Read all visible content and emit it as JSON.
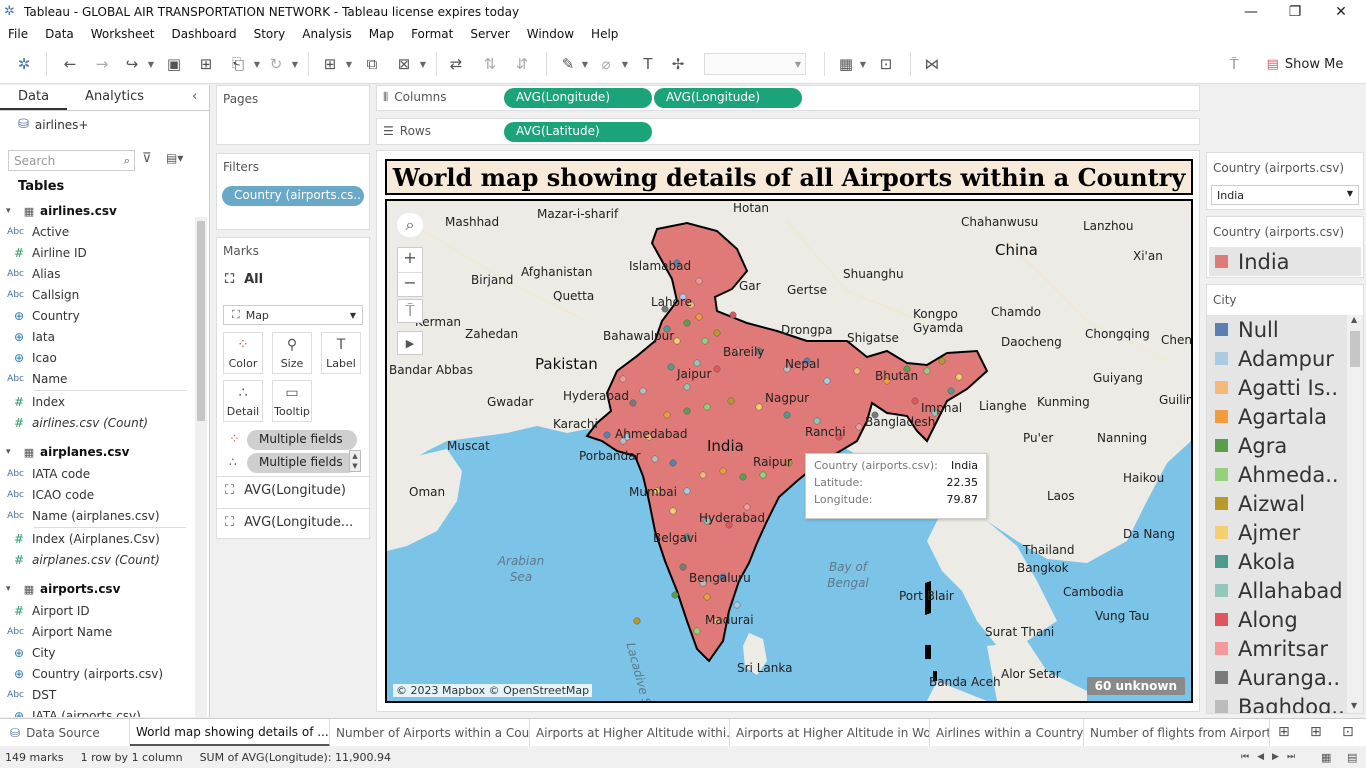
{
  "window": {
    "title": "Tableau - GLOBAL AIR TRANSPORTATION NETWORK - Tableau license expires today",
    "minimize": "—",
    "restore": "❐",
    "close": "✕"
  },
  "menu": [
    "File",
    "Data",
    "Worksheet",
    "Dashboard",
    "Story",
    "Analysis",
    "Map",
    "Format",
    "Server",
    "Window",
    "Help"
  ],
  "toolbar": {
    "show_me": "Show Me"
  },
  "datapane": {
    "tabs": [
      "Data",
      "Analytics"
    ],
    "source": "airlines+",
    "search_placeholder": "Search",
    "tables_label": "Tables",
    "tables": [
      {
        "name": "airlines.csv",
        "fields": [
          {
            "type": "Abc",
            "name": "Active"
          },
          {
            "type": "#",
            "name": "Airline ID"
          },
          {
            "type": "Abc",
            "name": "Alias"
          },
          {
            "type": "Abc",
            "name": "Callsign"
          },
          {
            "type": "globe",
            "name": "Country"
          },
          {
            "type": "globe",
            "name": "Iata"
          },
          {
            "type": "globe",
            "name": "Icao"
          },
          {
            "type": "Abc",
            "name": "Name"
          },
          {
            "type": "#",
            "name": "Index"
          },
          {
            "type": "#",
            "name": "airlines.csv (Count)"
          }
        ]
      },
      {
        "name": "airplanes.csv",
        "fields": [
          {
            "type": "Abc",
            "name": "IATA code"
          },
          {
            "type": "Abc",
            "name": "ICAO code"
          },
          {
            "type": "Abc",
            "name": "Name (airplanes.csv)"
          },
          {
            "type": "#",
            "name": "Index (Airplanes.Csv)"
          },
          {
            "type": "#",
            "name": "airplanes.csv (Count)"
          }
        ]
      },
      {
        "name": "airports.csv",
        "fields": [
          {
            "type": "#",
            "name": "Airport ID"
          },
          {
            "type": "Abc",
            "name": "Airport Name"
          },
          {
            "type": "globe",
            "name": "City"
          },
          {
            "type": "globe",
            "name": "Country (airports.csv)"
          },
          {
            "type": "Abc",
            "name": "DST"
          },
          {
            "type": "globe",
            "name": "IATA (airports.csv)"
          }
        ]
      }
    ]
  },
  "pages_label": "Pages",
  "filters": {
    "label": "Filters",
    "pill": "Country (airports.cs.."
  },
  "marks": {
    "label": "Marks",
    "all": "All",
    "type": "Map",
    "buttons": [
      "Color",
      "Size",
      "Label",
      "Detail",
      "Tooltip"
    ],
    "fields": [
      "Multiple fields",
      "Multiple fields"
    ],
    "layers": [
      "AVG(Longitude)",
      "AVG(Longitude..."
    ]
  },
  "shelves": {
    "columns_label": "Columns",
    "columns": [
      "AVG(Longitude)",
      "AVG(Longitude)"
    ],
    "rows_label": "Rows",
    "rows": [
      "AVG(Latitude)"
    ]
  },
  "view": {
    "title": "World map showing details of all Airports within a Country",
    "attribution": "© 2023 Mapbox © OpenStreetMap",
    "unknown": "60 unknown",
    "map_labels": [
      "Mashhad",
      "Mazar-i-sharif",
      "Hotan",
      "Chahanwusu",
      "Lanzhou",
      "China",
      "Xi'an",
      "Afghanistan",
      "Islamabad",
      "Birjand",
      "Shuanghu",
      "Gar",
      "Gertse",
      "Lahore",
      "Kerman",
      "Quetta",
      "Zahedan",
      "Bahawalpur",
      "Drongpa",
      "Shigatse",
      "Kongpo Gyamda",
      "Chamdo",
      "Daocheng",
      "Chongqing",
      "Chen",
      "Pakistan",
      "Bandar Abbas",
      "Bareily",
      "Nepal",
      "Bhutan",
      "Guiyang",
      "Jaipur",
      "Gwadar",
      "Hyderabad",
      "Karachi",
      "Nagpur",
      "Imphal",
      "Lianghe",
      "Kunming",
      "Guilin",
      "Porbandar",
      "Ahmedabad",
      "India",
      "Raipur",
      "Ranchi",
      "Bangladesh",
      "Pu'er",
      "Nanning",
      "Muscat",
      "Oman",
      "Mumbai",
      "Laos",
      "Haikou",
      "Hyderabad",
      "Da Nang",
      "Belgavi",
      "Thailand",
      "Bangkok",
      "Bengaluru",
      "Cambodia",
      "Port Blair",
      "Vung Tau",
      "Madurai",
      "Surat Thani",
      "Sri Lanka",
      "Alor Setar",
      "Banda Aceh",
      "Arabian Sea",
      "Bay of Bengal",
      "Lacadive Sea"
    ],
    "tooltip": {
      "rows": [
        {
          "k": "Country (airports.csv):",
          "v": "India"
        },
        {
          "k": "Latitude:",
          "v": "22.35"
        },
        {
          "k": "Longitude:",
          "v": "79.87"
        }
      ]
    }
  },
  "legends": {
    "filter_title": "Country (airports.csv)",
    "filter_value": "India",
    "color_title": "Country (airports.csv)",
    "color_value": "India",
    "color_value_hex": "#e07a78",
    "city_title": "City",
    "cities": [
      {
        "name": "Null",
        "color": "#5b7fb1"
      },
      {
        "name": "Adampur",
        "color": "#a9cce3"
      },
      {
        "name": "Agatti Is..",
        "color": "#f5b77a"
      },
      {
        "name": "Agartala",
        "color": "#f39c3c"
      },
      {
        "name": "Agra",
        "color": "#5a9e4d"
      },
      {
        "name": "Ahmeda..",
        "color": "#93d17a"
      },
      {
        "name": "Aizwal",
        "color": "#b89a2c"
      },
      {
        "name": "Ajmer",
        "color": "#f5cf6b"
      },
      {
        "name": "Akola",
        "color": "#4f9a8f"
      },
      {
        "name": "Allahabad",
        "color": "#92c7bd"
      },
      {
        "name": "Along",
        "color": "#e0575b"
      },
      {
        "name": "Amritsar",
        "color": "#f59a9a"
      },
      {
        "name": "Auranga..",
        "color": "#7a7a7a"
      },
      {
        "name": "Baghdog..",
        "color": "#bcbcbc"
      }
    ]
  },
  "sheet_tabs": [
    "Data Source",
    "World map showing details of ...",
    "Number of Airports within a Cou...",
    "Airports at Higher Altitude withi...",
    "Airports at Higher Altitude in Wo...",
    "Airlines within a Country",
    "Number of flights from Airports"
  ],
  "status": {
    "marks": "149 marks",
    "rows": "1 row by 1 column",
    "sum": "SUM of AVG(Longitude): 11,900.94"
  }
}
